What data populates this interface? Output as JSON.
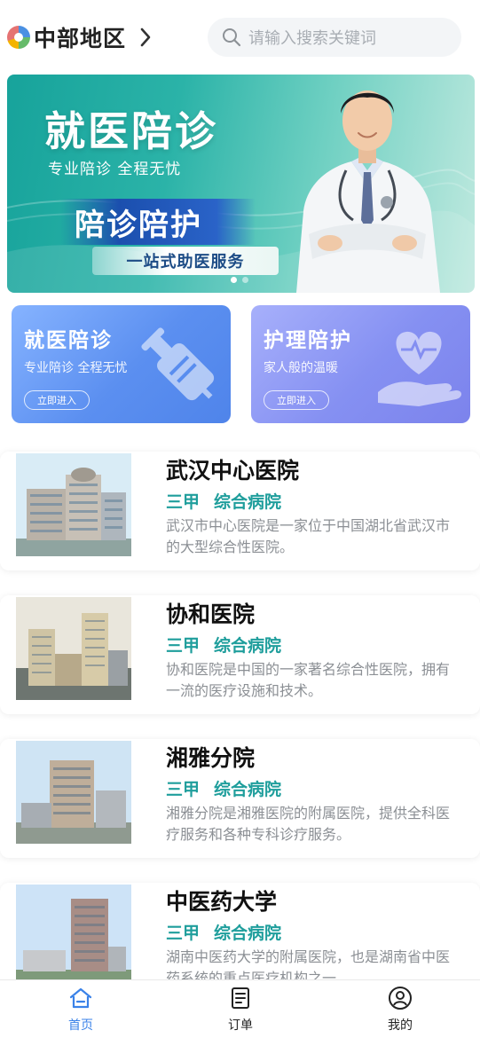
{
  "header": {
    "region": "中部地区",
    "search_placeholder": "请输入搜索关键词"
  },
  "banner": {
    "title": "就医陪诊",
    "subtitle": "专业陪诊 全程无忧",
    "tag": "陪诊陪护",
    "strip": "一站式助医服务",
    "slide_count": 2,
    "active_slide": 1
  },
  "services": [
    {
      "title": "就医陪诊",
      "subtitle": "专业陪诊 全程无忧",
      "button": "立即进入",
      "icon": "syringe-icon"
    },
    {
      "title": "护理陪护",
      "subtitle": "家人般的温暖",
      "button": "立即进入",
      "icon": "heart-hand-icon"
    }
  ],
  "hospitals": [
    {
      "name": "武汉中心医院",
      "level": "三甲",
      "type": "综合病院",
      "desc": "武汉市中心医院是一家位于中国湖北省武汉市的大型综合性医院。"
    },
    {
      "name": "协和医院",
      "level": "三甲",
      "type": "综合病院",
      "desc": "协和医院是中国的一家著名综合性医院，拥有一流的医疗设施和技术。"
    },
    {
      "name": "湘雅分院",
      "level": "三甲",
      "type": "综合病院",
      "desc": "湘雅分院是湘雅医院的附属医院，提供全科医疗服务和各种专科诊疗服务。"
    },
    {
      "name": "中医药大学",
      "level": "三甲",
      "type": "综合病院",
      "desc": "湖南中医药大学的附属医院，也是湖南省中医药系统的重点医疗机构之一。"
    }
  ],
  "tabbar": [
    {
      "label": "首页",
      "icon": "home-icon",
      "active": true
    },
    {
      "label": "订单",
      "icon": "order-icon",
      "active": false
    },
    {
      "label": "我的",
      "icon": "profile-icon",
      "active": false
    }
  ],
  "colors": {
    "accent": "#3a82e8",
    "tag_teal": "#1f9e9c",
    "banner_teal": "#17a39b",
    "card_blue": "#5b8ff0",
    "card_purple": "#8590f2"
  }
}
